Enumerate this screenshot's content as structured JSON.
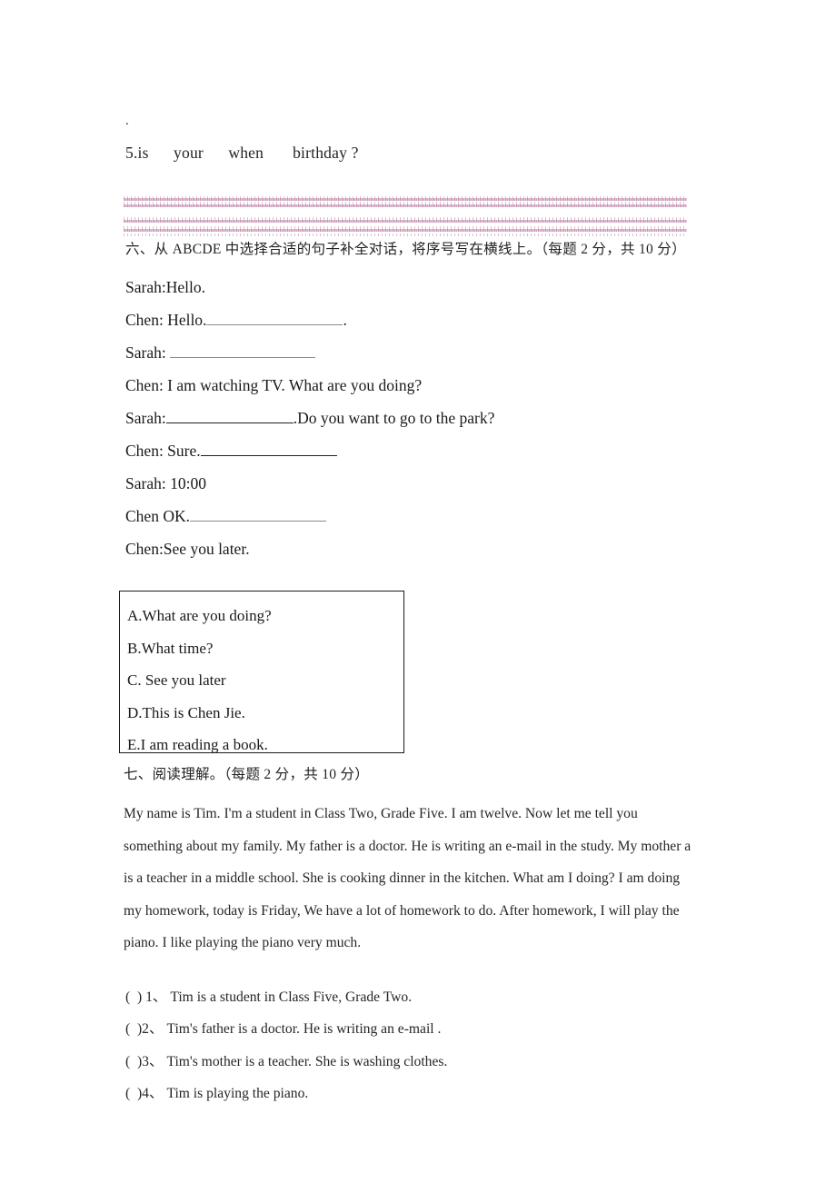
{
  "document": {
    "stray_mark": ".",
    "question5": "5.is      your      when       birthday ?"
  },
  "section_six": {
    "heading": "六、从 ABCDE 中选择合适的句子补全对话，将序号写在横线上。（每题 2 分，共 10 分）",
    "dialogue": [
      {
        "speaker": "Sarah:Hello.",
        "trailing": ""
      },
      {
        "speaker": "Chen: Hello.",
        "trailing": "."
      },
      {
        "speaker": "Sarah: ",
        "trailing": ""
      },
      {
        "speaker": "Chen:   I am watching TV. What are you doing?",
        "trailing": ""
      },
      {
        "speaker": "Sarah:",
        "trailing": ".Do you want to go to the park?"
      },
      {
        "speaker": "Chen: Sure.",
        "trailing": ""
      },
      {
        "speaker": "Sarah: 10:00",
        "trailing": ""
      },
      {
        "speaker": "Chen OK.",
        "trailing": ""
      },
      {
        "speaker": "Chen:See you later.",
        "trailing": ""
      }
    ],
    "options": [
      "A.What are you doing?",
      "B.What time?",
      "C. See you later",
      "D.This is Chen Jie.",
      "E.I am reading a book."
    ]
  },
  "section_seven": {
    "heading": "七、阅读理解。（每题 2 分，共 10 分）",
    "passage_lines": [
      "My name is Tim. I'm a student in Class Two, Grade Five. I am twelve. Now let me tell you",
      "something about my family. My father is a doctor. He is writing an e-mail in the study. My mother a",
      "is a teacher in a middle school. She is cooking dinner in the kitchen. What am I doing? I am doing",
      "my homework, today is Friday, We have a lot of homework to do. After homework, I will play the",
      "piano. I like playing the piano very much."
    ],
    "questions": [
      "(  ) 1、 Tim is a student in Class Five, Grade Two.",
      "(  )2、 Tim's father is a doctor. He is writing an e-mail .",
      "(  )3、 Tim's mother is a teacher. She is washing clothes.",
      "(  )4、 Tim is playing the piano."
    ]
  },
  "colors": {
    "text": "#1a1a1a",
    "rule_pink": "#c98c9e",
    "rule_violet": "#b9a7c9",
    "box_border": "#1a1a1a"
  }
}
